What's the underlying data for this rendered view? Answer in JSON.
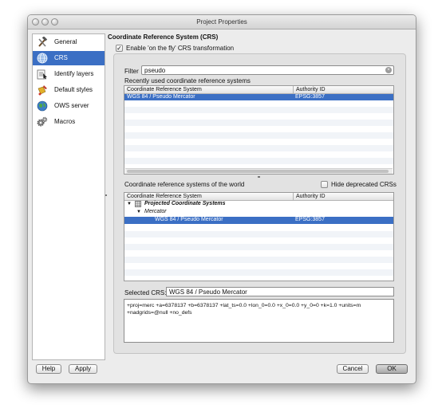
{
  "window": {
    "title": "Project Properties"
  },
  "sidebar": {
    "items": [
      {
        "label": "General",
        "icon": "hammer-wrench-icon",
        "selected": false
      },
      {
        "label": "CRS",
        "icon": "globe-icon",
        "selected": true
      },
      {
        "label": "Identify layers",
        "icon": "identify-icon",
        "selected": false
      },
      {
        "label": "Default styles",
        "icon": "paint-icon",
        "selected": false
      },
      {
        "label": "OWS server",
        "icon": "globe-server-icon",
        "selected": false
      },
      {
        "label": "Macros",
        "icon": "gears-icon",
        "selected": false
      }
    ]
  },
  "crs": {
    "section_title": "Coordinate Reference System (CRS)",
    "otf_label": "Enable 'on the fly' CRS transformation",
    "otf_checked": true,
    "filter_label": "Filter",
    "filter_value": "pseudo",
    "recent_label": "Recently used coordinate reference systems",
    "recent_table": {
      "columns": [
        "Coordinate Reference System",
        "Authority ID"
      ],
      "rows": [
        {
          "name": "WGS 84 / Pseudo Mercator",
          "id": "EPSG:3857",
          "selected": true
        }
      ]
    },
    "world_label": "Coordinate reference systems of the world",
    "hide_deprecated_label": "Hide deprecated CRSs",
    "hide_deprecated_checked": false,
    "world_table": {
      "columns": [
        "Coordinate Reference System",
        "Authority ID"
      ],
      "group": "Projected Coordinate Systems",
      "subgroup": "Mercator",
      "item": {
        "name": "WGS 84 / Pseudo Mercator",
        "id": "EPSG:3857",
        "selected": true
      }
    },
    "selected_crs_label": "Selected CRS:",
    "selected_crs_value": "WGS 84 / Pseudo Mercator",
    "proj4_line1": "+proj=merc +a=6378137 +b=6378137 +lat_ts=0.0 +lon_0=0.0 +x_0=0.0 +y_0=0 +k=1.0 +units=m",
    "proj4_line2": "+nadgrids=@null +no_defs"
  },
  "buttons": {
    "help": "Help",
    "apply": "Apply",
    "cancel": "Cancel",
    "ok": "OK"
  },
  "colors": {
    "selection": "#3b6fc4",
    "window_bg": "#ececec"
  }
}
